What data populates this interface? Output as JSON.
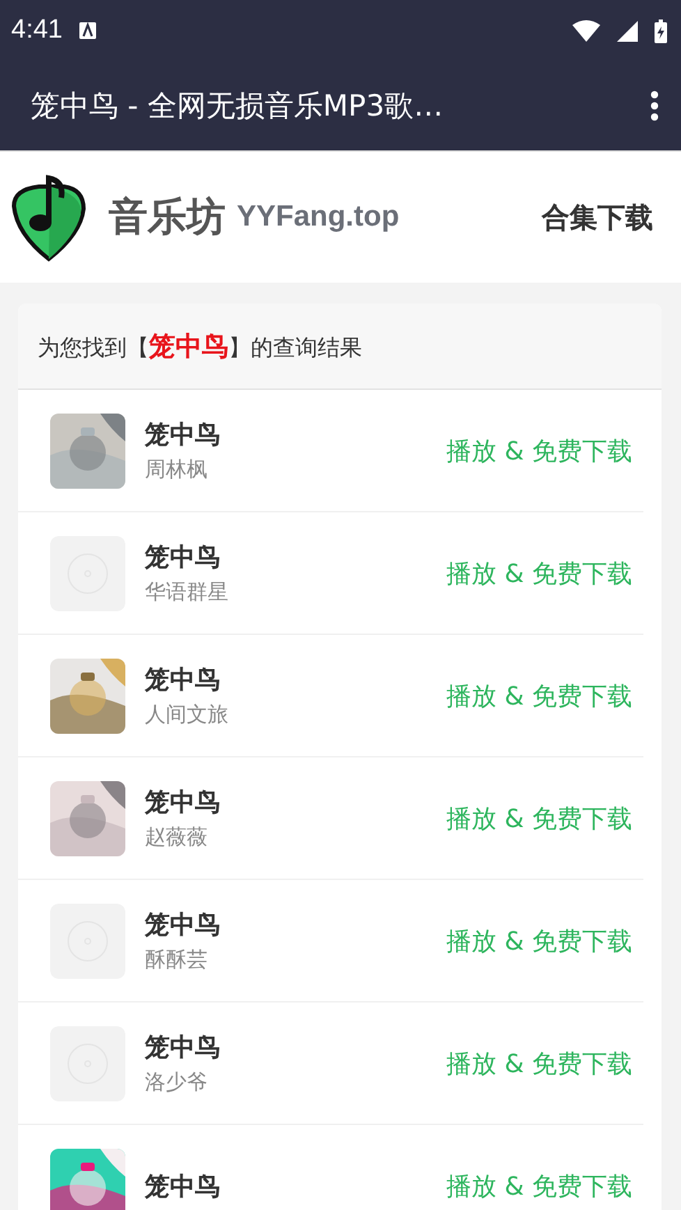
{
  "status_bar": {
    "time": "4:41"
  },
  "app_bar": {
    "title": "笼中鸟 - 全网无损音乐MP3歌…"
  },
  "site_header": {
    "brand": "音乐坊",
    "domain": "YYFang.top",
    "link": "合集下载"
  },
  "results": {
    "summary": "为您找到【**笼中鸟**】的查询结果",
    "rows": [
      {
        "title": "笼中鸟",
        "artist": "周林枫",
        "kind": "picture",
        "action": "播放 & 免费下载"
      },
      {
        "title": "笼中鸟",
        "artist": "华语群星",
        "kind": "placeholder",
        "action": "播放 & 免费下载"
      },
      {
        "title": "笼中鸟",
        "artist": "人间文旅",
        "kind": "picture",
        "action": "播放 & 免费下载"
      },
      {
        "title": "笼中鸟",
        "artist": "赵薇薇",
        "kind": "picture",
        "action": "播放 & 免费下载"
      },
      {
        "title": "笼中鸟",
        "artist": "酥酥芸",
        "kind": "placeholder",
        "action": "播放 & 免费下载"
      },
      {
        "title": "笼中鸟",
        "artist": "洛少爷",
        "kind": "placeholder",
        "action": "播放 & 免费下载"
      },
      {
        "title": "笼中鸟",
        "kind": "picture",
        "action": "播放 & 免费下载"
      }
    ]
  }
}
